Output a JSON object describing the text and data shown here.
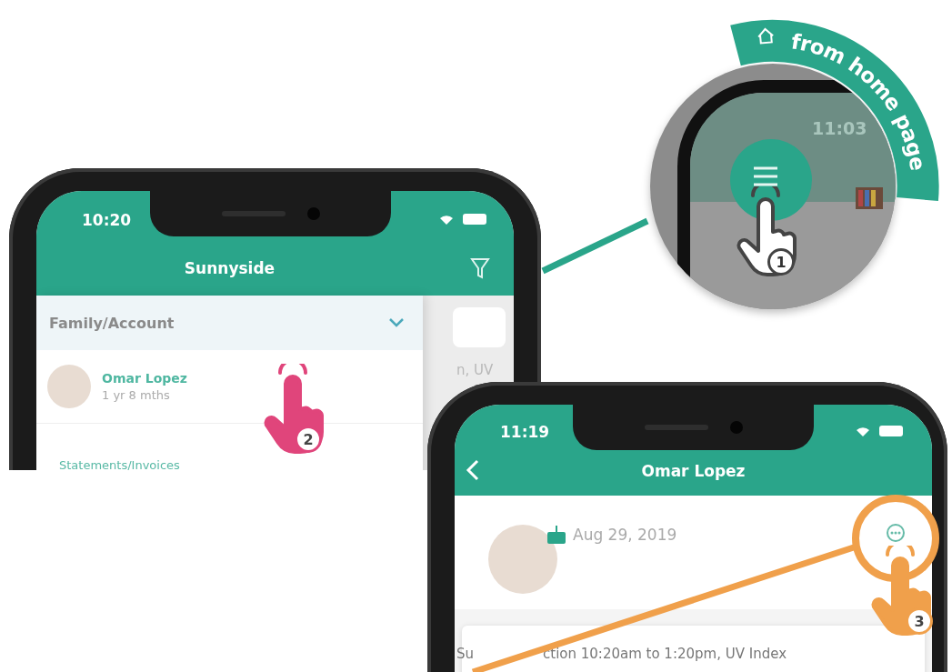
{
  "callout_home": {
    "label": "from home page",
    "time": "11:03",
    "step": "1"
  },
  "phone_list": {
    "time": "10:20",
    "title": "Sunnyside",
    "section": "Family/Account",
    "expanded": true,
    "child_name": "Omar Lopez",
    "child_age": "1 yr 8 mths",
    "next_item": "Statements/Invoices",
    "background_text": "n, UV",
    "step": "2"
  },
  "phone_profile": {
    "time": "11:19",
    "title": "Omar Lopez",
    "birthday": "Aug 29, 2019",
    "note_start": "Su",
    "note_end": "ction 10:20am to 1:20pm, UV Index",
    "step": "3"
  }
}
